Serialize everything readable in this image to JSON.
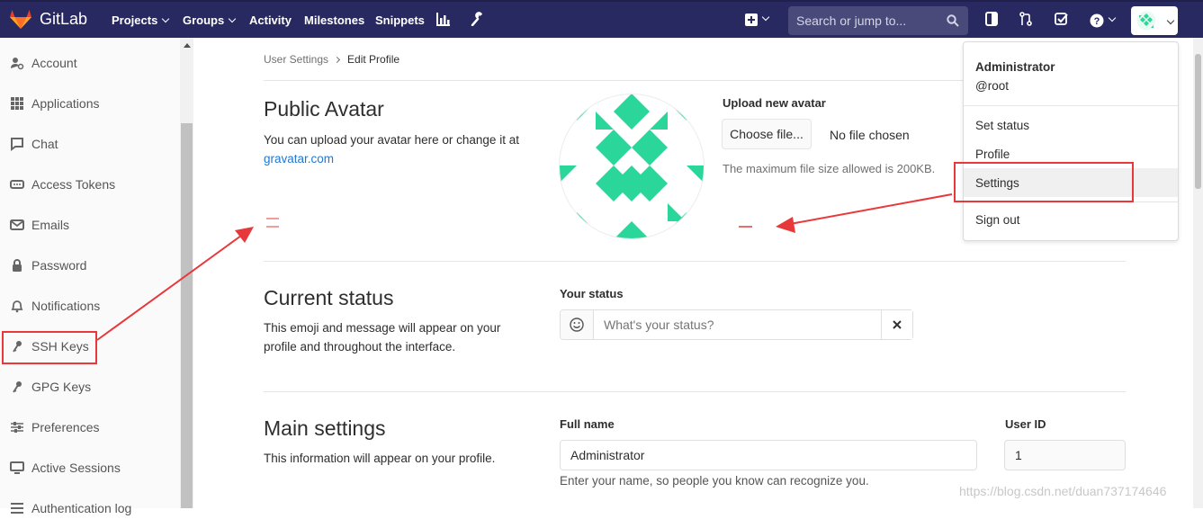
{
  "navbar": {
    "brand": "GitLab",
    "links": [
      "Projects",
      "Groups",
      "Activity",
      "Milestones",
      "Snippets"
    ],
    "search_placeholder": "Search or jump to..."
  },
  "sidebar": {
    "items": [
      {
        "label": "Account",
        "icon": "account-icon"
      },
      {
        "label": "Applications",
        "icon": "applications-icon"
      },
      {
        "label": "Chat",
        "icon": "chat-icon"
      },
      {
        "label": "Access Tokens",
        "icon": "token-icon"
      },
      {
        "label": "Emails",
        "icon": "email-icon"
      },
      {
        "label": "Password",
        "icon": "lock-icon"
      },
      {
        "label": "Notifications",
        "icon": "bell-icon"
      },
      {
        "label": "SSH Keys",
        "icon": "key-icon"
      },
      {
        "label": "GPG Keys",
        "icon": "key-icon"
      },
      {
        "label": "Preferences",
        "icon": "preferences-icon"
      },
      {
        "label": "Active Sessions",
        "icon": "monitor-icon"
      },
      {
        "label": "Authentication log",
        "icon": "list-icon"
      }
    ]
  },
  "breadcrumb": {
    "parent": "User Settings",
    "current": "Edit Profile"
  },
  "avatar_section": {
    "title": "Public Avatar",
    "desc": "You can upload your avatar here or change it at",
    "link": "gravatar.com",
    "upload_label": "Upload new avatar",
    "choose_button": "Choose file...",
    "no_file": "No file chosen",
    "max_size": "The maximum file size allowed is 200KB."
  },
  "status_section": {
    "title": "Current status",
    "desc": "This emoji and message will appear on your profile and throughout the interface.",
    "label": "Your status",
    "placeholder": "What's your status?"
  },
  "main_settings": {
    "title": "Main settings",
    "desc": "This information will appear on your profile.",
    "full_name_label": "Full name",
    "full_name_value": "Administrator",
    "full_name_help": "Enter your name, so people you know can recognize you.",
    "user_id_label": "User ID",
    "user_id_value": "1"
  },
  "user_dropdown": {
    "name": "Administrator",
    "username": "@root",
    "items": [
      "Set status",
      "Profile",
      "Settings",
      "Sign out"
    ]
  },
  "colors": {
    "navbar": "#292961",
    "avatar_green": "#2bd69a",
    "annotation_red": "#e8383a",
    "link": "#1f78d1"
  },
  "watermark": "https://blog.csdn.net/duan737174646"
}
